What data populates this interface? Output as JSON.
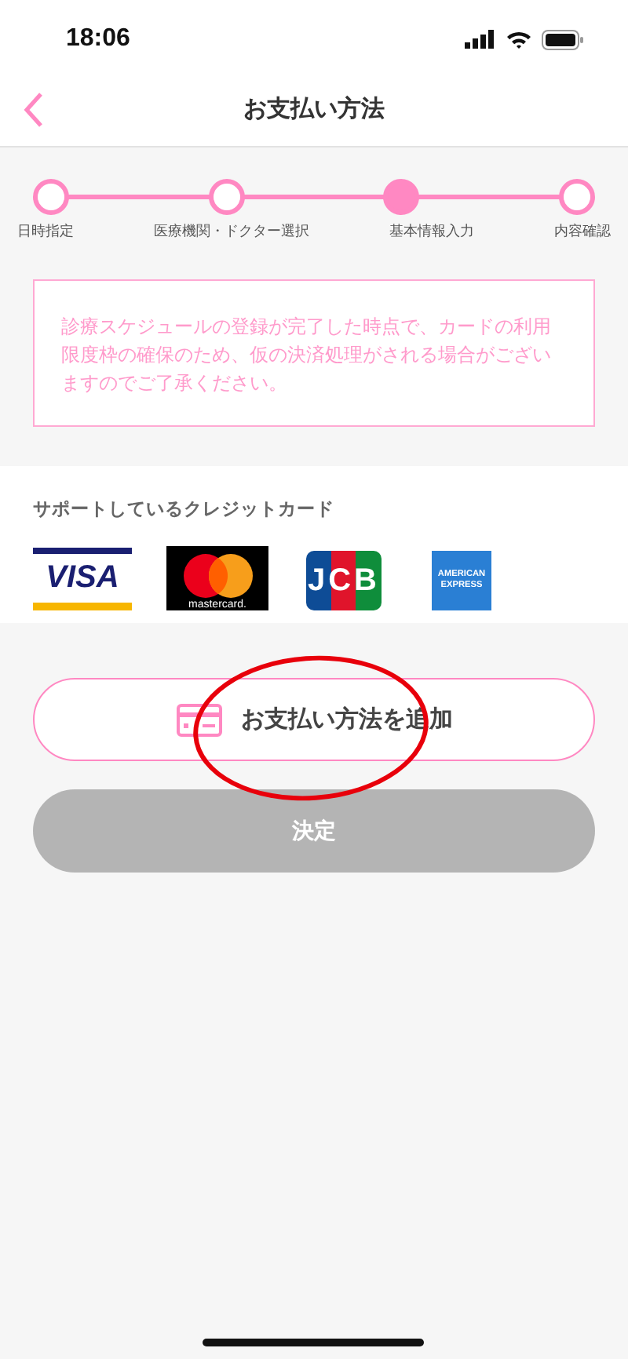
{
  "status_bar": {
    "time": "18:06"
  },
  "header": {
    "title": "お支払い方法"
  },
  "steps": [
    {
      "label": "日時指定",
      "selected": false
    },
    {
      "label": "医療機関・ドクター選択",
      "selected": false
    },
    {
      "label": "基本情報入力",
      "selected": true
    },
    {
      "label": "内容確認",
      "selected": false
    }
  ],
  "notice": "診療スケジュールの登録が完了した時点で、カードの利用限度枠の確保のため、仮の決済処理がされる場合がございますのでご了承ください。",
  "supported_cards": {
    "heading": "サポートしているクレジットカード",
    "cards": [
      {
        "kind": "visa",
        "label": "VISA"
      },
      {
        "kind": "mastercard",
        "label": "mastercard."
      },
      {
        "kind": "jcb",
        "label": "JCB"
      },
      {
        "kind": "amex",
        "label": "AMERICAN EXPRESS"
      }
    ]
  },
  "add_button": {
    "label": "お支払い方法を追加"
  },
  "submit_button": {
    "label": "決定",
    "disabled": true
  },
  "annotation": {
    "kind": "ellipse"
  }
}
